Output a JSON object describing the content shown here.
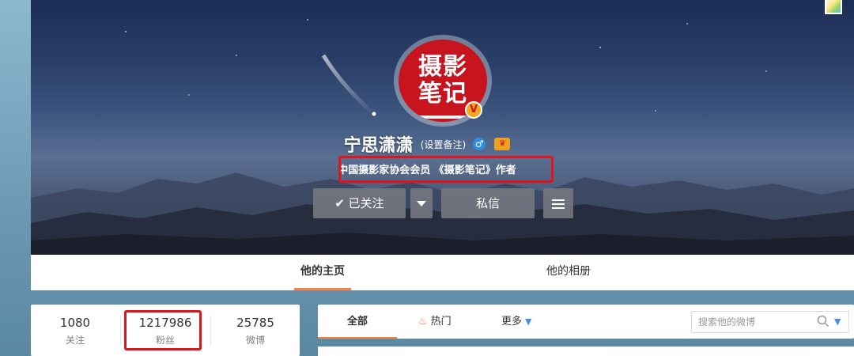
{
  "profile": {
    "avatar_text_line1": "摄影",
    "avatar_text_line2": "笔记",
    "name": "宁思潇潇",
    "remark_link": "(设置备注)",
    "gender_symbol": "♂",
    "bio": "中国摄影家协会会员 《摄影笔记》作者"
  },
  "actions": {
    "follow_label": "已关注",
    "follow_check": "✔",
    "message_label": "私信"
  },
  "tabs": {
    "home": "他的主页",
    "album": "他的相册"
  },
  "stats": {
    "following": {
      "value": "1080",
      "label": "关注"
    },
    "fans": {
      "value": "1217986",
      "label": "粉丝"
    },
    "weibo": {
      "value": "25785",
      "label": "微博"
    }
  },
  "feed_nav": {
    "all": "全部",
    "hot": "热门",
    "more": "更多"
  },
  "search": {
    "placeholder": "搜索他的微博"
  },
  "icons": {
    "verified": "verified-badge-icon",
    "gender": "male-icon",
    "vip": "vip-crown-icon",
    "fire": "fire-icon",
    "search": "search-icon"
  },
  "colors": {
    "accent_orange": "#ff8140",
    "highlight_red": "#e0141a",
    "avatar_red": "#c8141e",
    "link_blue": "#4a8ee0"
  }
}
